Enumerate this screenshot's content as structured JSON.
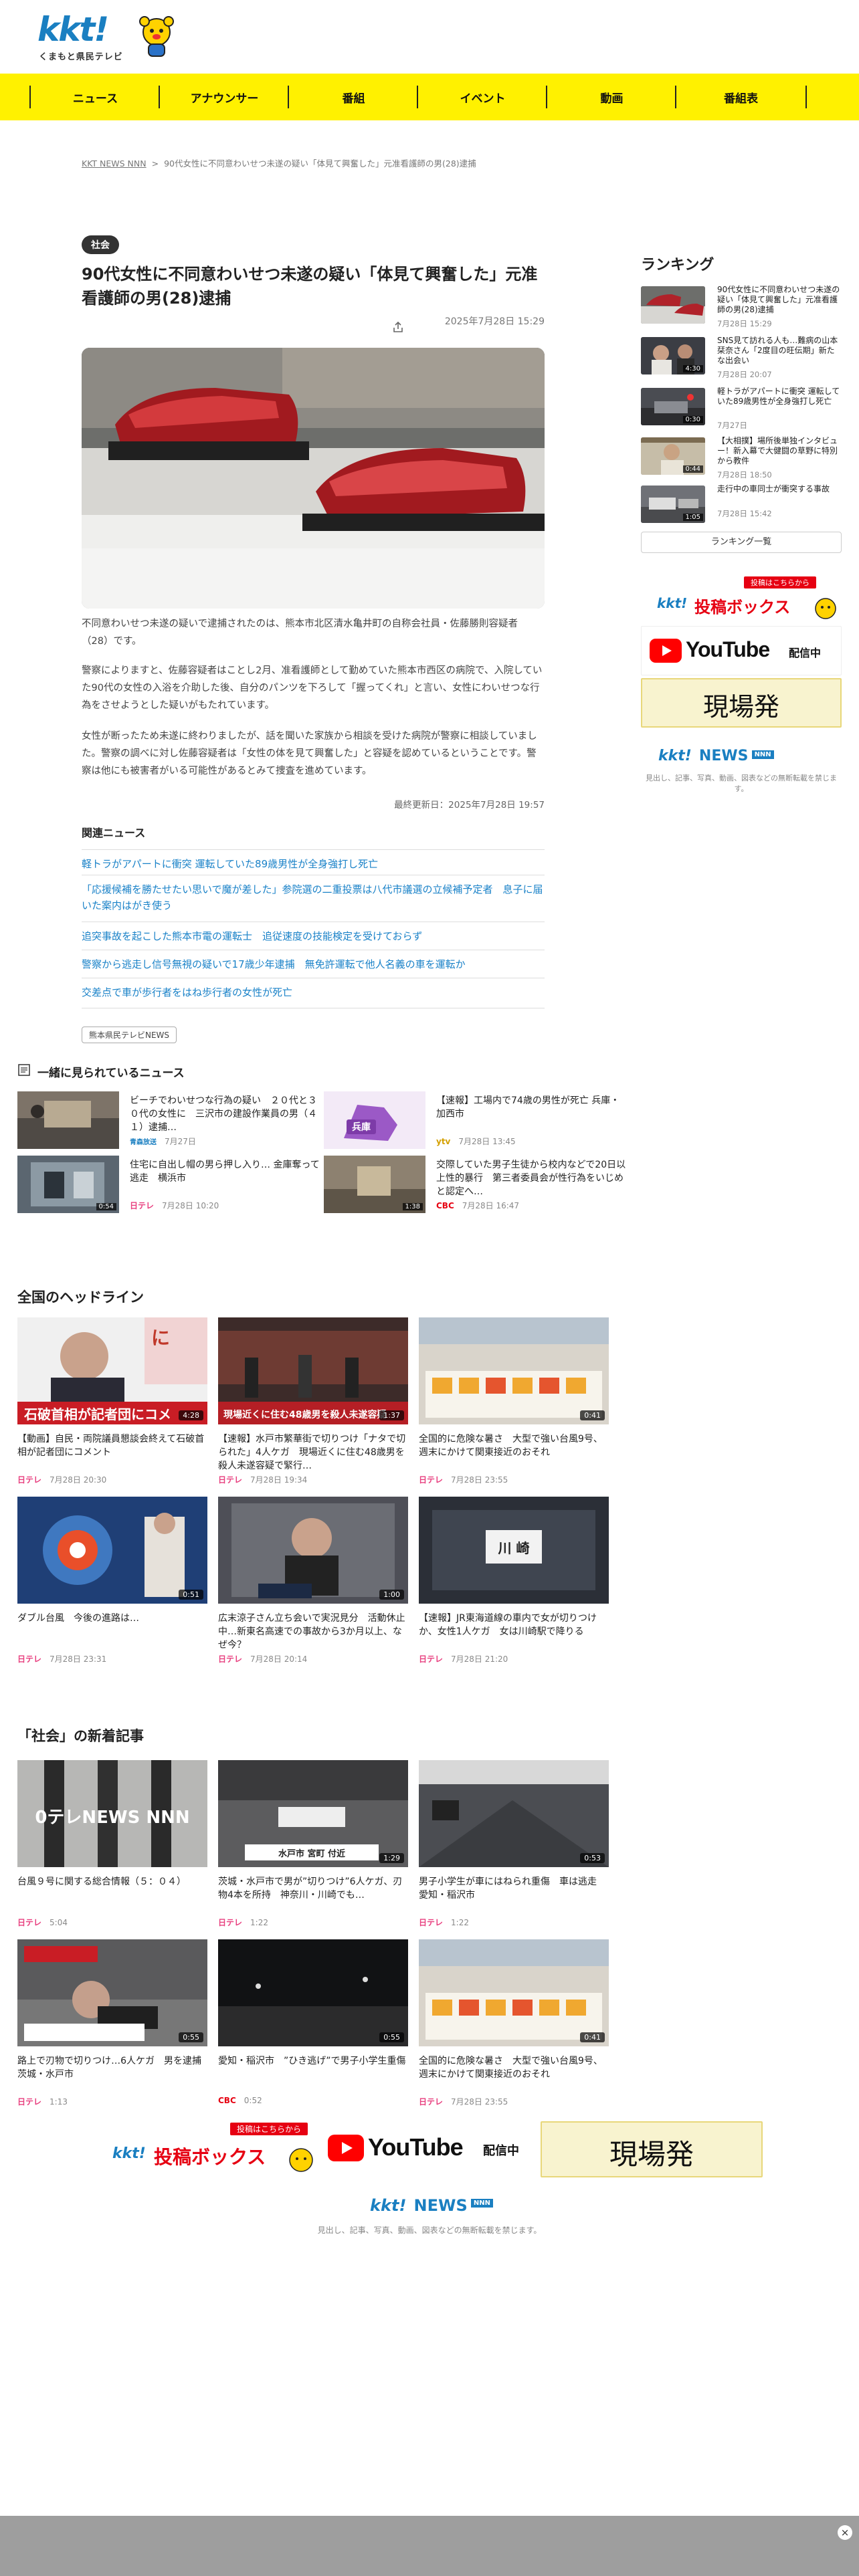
{
  "header": {
    "logo_text": "kkt!",
    "logo_sub": "くまもと県民テレビ"
  },
  "nav": [
    "ニュース",
    "アナウンサー",
    "番組",
    "イベント",
    "動画",
    "番組表"
  ],
  "breadcrumb": {
    "root": "KKT NEWS NNN",
    "sep": ">",
    "current": "90代女性に不同意わいせつ未遂の疑い「体見て興奮した」元准看護師の男(28)逮捕"
  },
  "article": {
    "category": "社会",
    "title": "90代女性に不同意わいせつ未遂の疑い「体見て興奮した」元准看護師の男(28)逮捕",
    "date": "2025年7月28日 15:29",
    "paragraphs": [
      "不同意わいせつ未遂の疑いで逮捕されたのは、熊本市北区清水亀井町の自称会社員・佐藤勝則容疑者（28）です。",
      "警察によりますと、佐藤容疑者はことし2月、准看護師として勤めていた熊本市西区の病院で、入院していた90代の女性の入浴を介助した後、自分のパンツを下ろして「握ってくれ」と言い、女性にわいせつな行為をさせようとした疑いがもたれています。",
      "女性が断ったため未遂に終わりましたが、話を聞いた家族から相談を受けた病院が警察に相談していました。警察の調べに対し佐藤容疑者は「女性の体を見て興奮した」と容疑を認めているということです。警察は他にも被害者がいる可能性があるとみて捜査を進めています。"
    ],
    "updated": "最終更新日：2025年7月28日 19:57",
    "related_heading": "関連ニュース",
    "related": [
      "軽トラがアパートに衝突 運転していた89歳男性が全身強打し死亡",
      "「応援候補を勝たせたい思いで魔が差した」参院選の二重投票は八代市議選の立候補予定者　息子に届いた案内はがき使う",
      "追突事故を起こした熊本市電の運転士　追従速度の技能検定を受けておらず",
      "警察から逃走し信号無視の疑いで17歳少年逮捕　無免許運転で他人名義の車を運転か",
      "交差点で車が歩行者をはね歩行者の女性が死亡"
    ],
    "tag": "熊本県民テレビNEWS"
  },
  "ranking": {
    "heading": "ランキング",
    "items": [
      {
        "title": "90代女性に不同意わいせつ未遂の疑い「体見て興奮した」元准看護師の男(28)逮捕",
        "date": "7月28日 15:29",
        "dur": ""
      },
      {
        "title": "SNS見て訪れる人も…難病の山本栞奈さん「2度目の旺伝期」新たな出会い",
        "date": "7月28日 20:07",
        "dur": "4:30"
      },
      {
        "title": "軽トラがアパートに衝突 運転していた89歳男性が全身強打し死亡",
        "date": "7月27日",
        "dur": "0:30"
      },
      {
        "title": "【大相撲】場所後単独インタビュー！新入幕で大健闘の草野に特別から教件",
        "date": "7月28日 18:50",
        "dur": "0:44"
      },
      {
        "title": "走行中の車同士が衝突する事故",
        "date": "7月28日 15:42",
        "dur": "1:05"
      }
    ],
    "all_label": "ランキング一覧"
  },
  "banners": {
    "toukou_top": "投稿はこちらから",
    "toukou_main": "投稿ボックス",
    "youtube": "YouTube",
    "youtube_sub": "配信中",
    "genba": "現場発",
    "kktnews": "NEWS",
    "kktnews_kkt": "kkt!",
    "nnn": "NNN",
    "notice": "見出し、記事、写真、動画、図表などの無断転載を禁じます。"
  },
  "together": {
    "heading": "一緒に見られているニュース",
    "items": [
      {
        "title": "ビーチでわいせつな行為の疑い　２０代と３０代の女性に　三沢市の建設作業員の男（４１）逮捕…",
        "source": "青森放送",
        "date": "7月27日",
        "dur": ""
      },
      {
        "title": "【速報】工場内で74歳の男性が死亡 兵庫・加西市",
        "source": "ytv",
        "date": "7月28日 13:45",
        "dur": ""
      },
      {
        "title": "住宅に自出し帽の男ら押し入り… 金庫奪って逃走　横浜市",
        "source": "日テレ",
        "date": "7月28日 10:20",
        "dur": "0:54"
      },
      {
        "title": "交際していた男子生徒から校内などで20日以上性的暴行　第三者委員会が性行為をいじめと認定へ…",
        "source": "CBC",
        "date": "7月28日 16:47",
        "dur": "1:38"
      }
    ]
  },
  "national": {
    "heading": "全国のヘッドライン",
    "items": [
      {
        "title": "【動画】自民・両院議員懇談会終えて石破首相が記者団にコメント",
        "source": "日テレ",
        "date": "7月28日 20:30",
        "dur": "4:28"
      },
      {
        "title": "【速報】水戸市繁華街で切りつけ「ナタで切られた」4人ケガ　現場近くに住む48歳男を殺人未遂容疑で緊行…",
        "source": "日テレ",
        "date": "7月28日 19:34",
        "dur": "1:37"
      },
      {
        "title": "全国的に危険な暑さ　大型で強い台風9号、週末にかけて関東接近のおそれ",
        "source": "日テレ",
        "date": "7月28日 23:55",
        "dur": "0:41"
      },
      {
        "title": "ダブル台風　今後の進路は…",
        "source": "日テレ",
        "date": "7月28日 23:31",
        "dur": "0:51"
      },
      {
        "title": "広末涼子さん立ち会いで実況見分　活動休止中…新東名高速での事故から3か月以上、なぜ今？",
        "source": "日テレ",
        "date": "7月28日 20:14",
        "dur": "1:00"
      },
      {
        "title": "【速報】JR東海道線の車内で女が切りつけか、女性1人ケガ　女は川崎駅で降りる",
        "source": "日テレ",
        "date": "7月28日 21:20",
        "dur": ""
      }
    ]
  },
  "social": {
    "heading": "「社会」の新着記事",
    "items": [
      {
        "title": "台風９号に関する総合情報（５：０４）",
        "source": "日テレ",
        "date": "5:04",
        "dur": ""
      },
      {
        "title": "茨城・水戸市で男が”切りつけ”6人ケガ、刃物4本を所持　神奈川・川崎でも…",
        "source": "日テレ",
        "date": "1:22",
        "dur": "1:29"
      },
      {
        "title": "男子小学生が車にはねられ重傷　車は逃走　愛知・稲沢市",
        "source": "日テレ",
        "date": "1:22",
        "dur": "0:53"
      },
      {
        "title": "路上で刃物で切りつけ…6人ケガ　男を逮捕　茨城・水戸市",
        "source": "日テレ",
        "date": "1:13",
        "dur": "0:55"
      },
      {
        "title": "愛知・稲沢市　”ひき逃げ”で男子小学生重傷",
        "source": "CBC",
        "date": "0:52",
        "dur": "0:55"
      },
      {
        "title": "全国的に危険な暑さ　大型で強い台風9号、週末にかけて関東接近のおそれ",
        "source": "日テレ",
        "date": "7月28日 23:55",
        "dur": "0:41"
      }
    ]
  },
  "colors": {
    "yellow": "#fff100",
    "blue": "#1a7fc1",
    "link": "#1a82c8",
    "pink": "#e83f7f"
  }
}
